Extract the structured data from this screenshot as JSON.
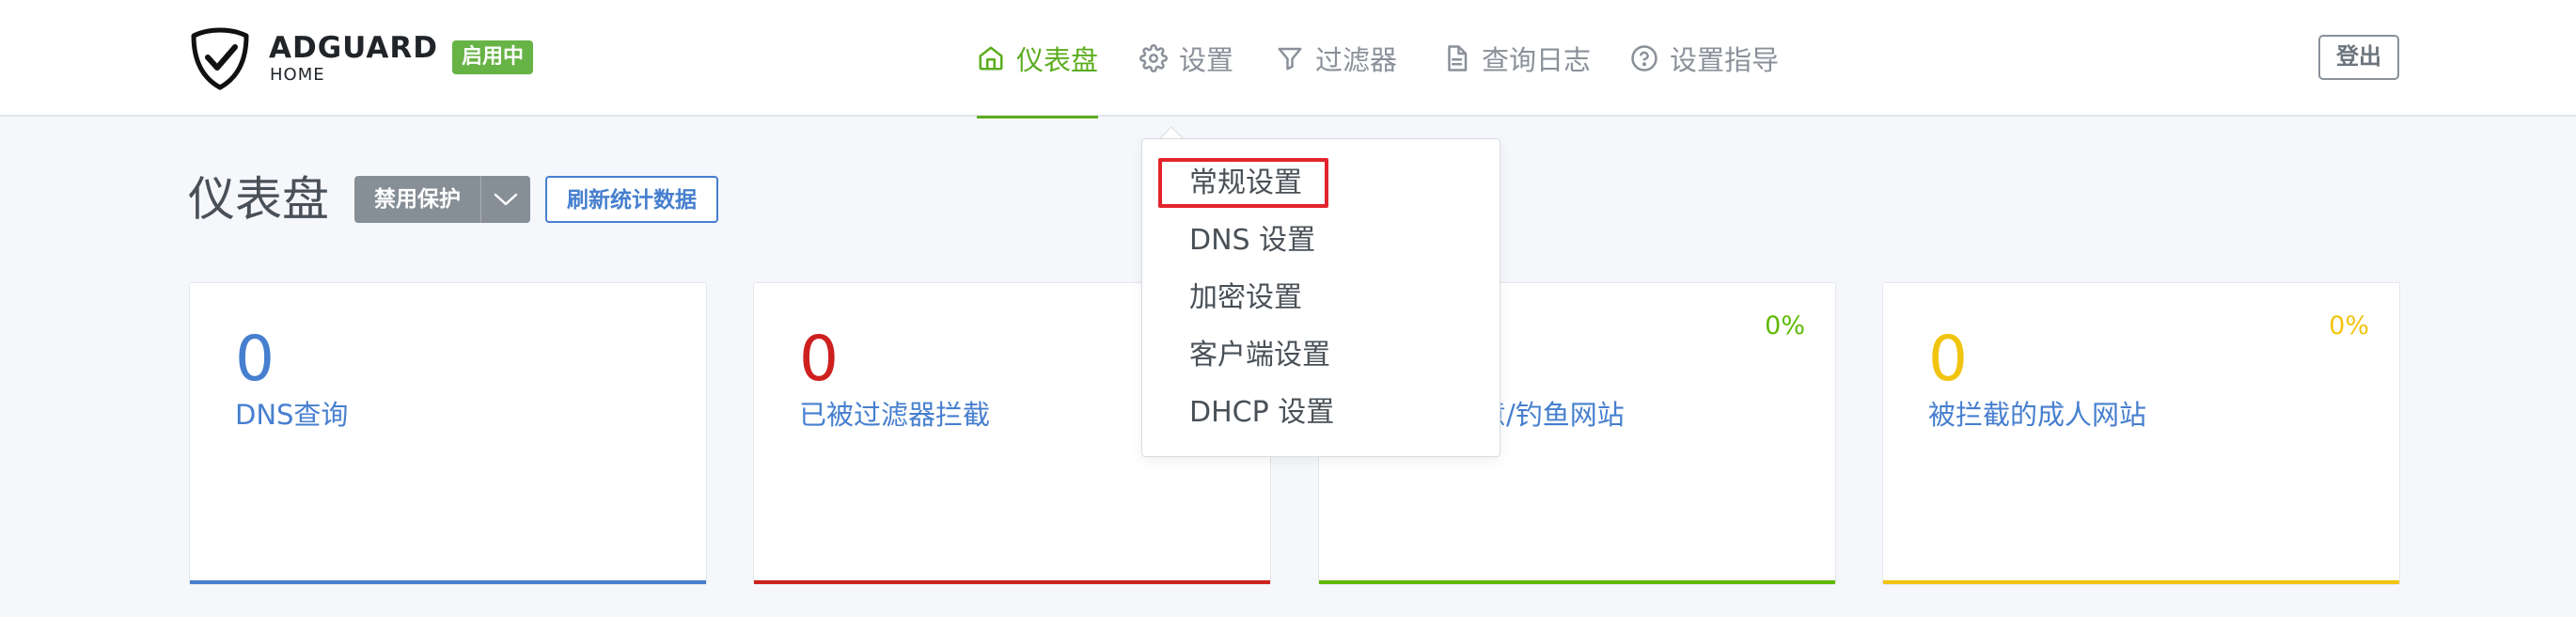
{
  "brand": {
    "name": "ADGUARD",
    "sub": "HOME",
    "status_badge": "启用中"
  },
  "nav": {
    "items": [
      {
        "label": "仪表盘",
        "icon": "home-icon",
        "active": true
      },
      {
        "label": "设置",
        "icon": "gear-icon",
        "active": false
      },
      {
        "label": "过滤器",
        "icon": "filter-icon",
        "active": false
      },
      {
        "label": "查询日志",
        "icon": "document-icon",
        "active": false
      },
      {
        "label": "设置指导",
        "icon": "help-circle-icon",
        "active": false
      }
    ],
    "logout_label": "登出"
  },
  "page": {
    "title": "仪表盘",
    "disable_protection_label": "禁用保护",
    "refresh_label": "刷新统计数据"
  },
  "settings_menu": {
    "items": [
      "常规设置",
      "DNS 设置",
      "加密设置",
      "客户端设置",
      "DHCP 设置"
    ],
    "highlighted_index": 0
  },
  "cards": [
    {
      "count": "0",
      "label": "DNS查询",
      "percent": "",
      "color": "#467fcf"
    },
    {
      "count": "0",
      "label": "已被过滤器拦截",
      "percent": "",
      "color": "#cd201f"
    },
    {
      "count": "",
      "label": "意/钓鱼网站",
      "percent": "0%",
      "color": "#5eba00"
    },
    {
      "count": "0",
      "label": "被拦截的成人网站",
      "percent": "0%",
      "color": "#f1c40f"
    }
  ],
  "colors": {
    "accent_green": "#5cad1f",
    "badge_green": "#67b346",
    "primary_blue": "#467fcf",
    "highlight_red": "#e3232d"
  }
}
